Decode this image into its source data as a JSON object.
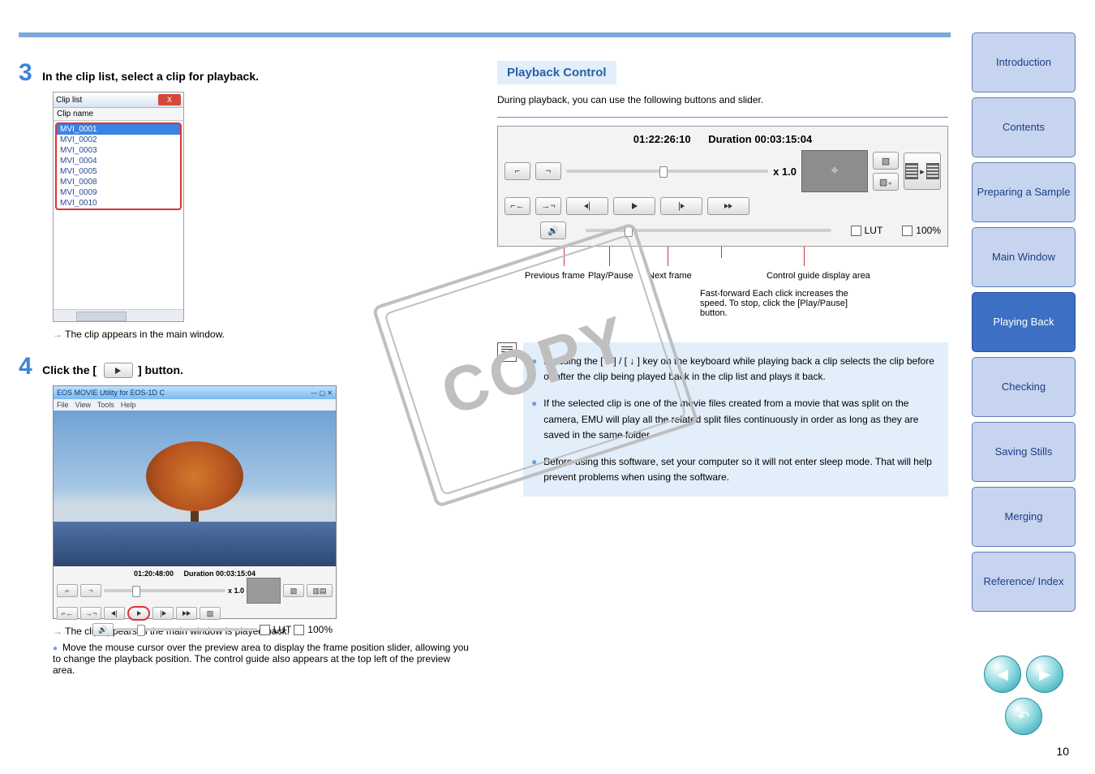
{
  "page_number": "10",
  "watermark": "COPY",
  "step3": {
    "num": "3",
    "title": "In the clip list, select a clip for playback.",
    "clipwin": {
      "title": "Clip list",
      "close": "X",
      "header": "Clip name",
      "rows": [
        "MVI_0001",
        "MVI_0002",
        "MVI_0003",
        "MVI_0004",
        "MVI_0005",
        "MVI_0008",
        "MVI_0009",
        "MVI_0010"
      ]
    },
    "arrow": "→",
    "arrow_text": "The clip appears in the main window."
  },
  "step4": {
    "num": "4",
    "title_pre": "Click the [",
    "title_post": "] button.",
    "mainwin": {
      "title": "EOS MOVIE Utility for EOS-1D C",
      "menus": [
        "File",
        "View",
        "Tools",
        "Help"
      ],
      "tc": "01:20:48:00",
      "dur_label": "Duration",
      "dur": "00:03:15:04",
      "speed": "x 1.0",
      "lut": "LUT",
      "hundred": "100%"
    },
    "arrow": "→",
    "arrow_text": "The clip appears in the main window is played back.",
    "bullet": "Move the mouse cursor over the preview area to display the frame position slider, allowing you to change the playback position. The control guide also appears at the top left of the preview area."
  },
  "pc": {
    "title": "Playback Control",
    "desc": "During playback, you can use the following buttons and slider.",
    "tc": "01:22:26:10",
    "dur_label": "Duration",
    "dur": "00:03:15:04",
    "speed": "x 1.0",
    "lut": "LUT",
    "hundred": "100%",
    "labels": {
      "prev": "Previous frame",
      "play": "Play/Pause",
      "next": "Next frame",
      "fast": "Fast-forward Each click increases the speed. To stop, click the [Play/Pause] button.",
      "guide": "Control guide display area"
    }
  },
  "notes": {
    "n1_a": "Pressing the [",
    "n1_up": "↑",
    "n1_b": "] / [",
    "n1_dn": "↓",
    "n1_c": "] key on the keyboard while playing back a clip selects the clip before or after the clip being played back in the clip list and plays it back.",
    "n2": "If the selected clip is one of the movie files created from a movie that was split on the camera, EMU will play all the related split files continuously in order as long as they are saved in the same folder.",
    "n3": "Before using this software, set your computer so it will not enter sleep mode. That will help prevent problems when using the software."
  },
  "sidenav": [
    {
      "label": "Introduction",
      "active": false
    },
    {
      "label": "Contents",
      "active": false
    },
    {
      "label": "Preparing a Sample",
      "active": false
    },
    {
      "label": "Main Window",
      "active": false
    },
    {
      "label": "Playing Back",
      "active": true
    },
    {
      "label": "Checking",
      "active": false
    },
    {
      "label": "Saving Stills",
      "active": false
    },
    {
      "label": "Merging",
      "active": false
    },
    {
      "label": "Reference/ Index",
      "active": false
    }
  ]
}
